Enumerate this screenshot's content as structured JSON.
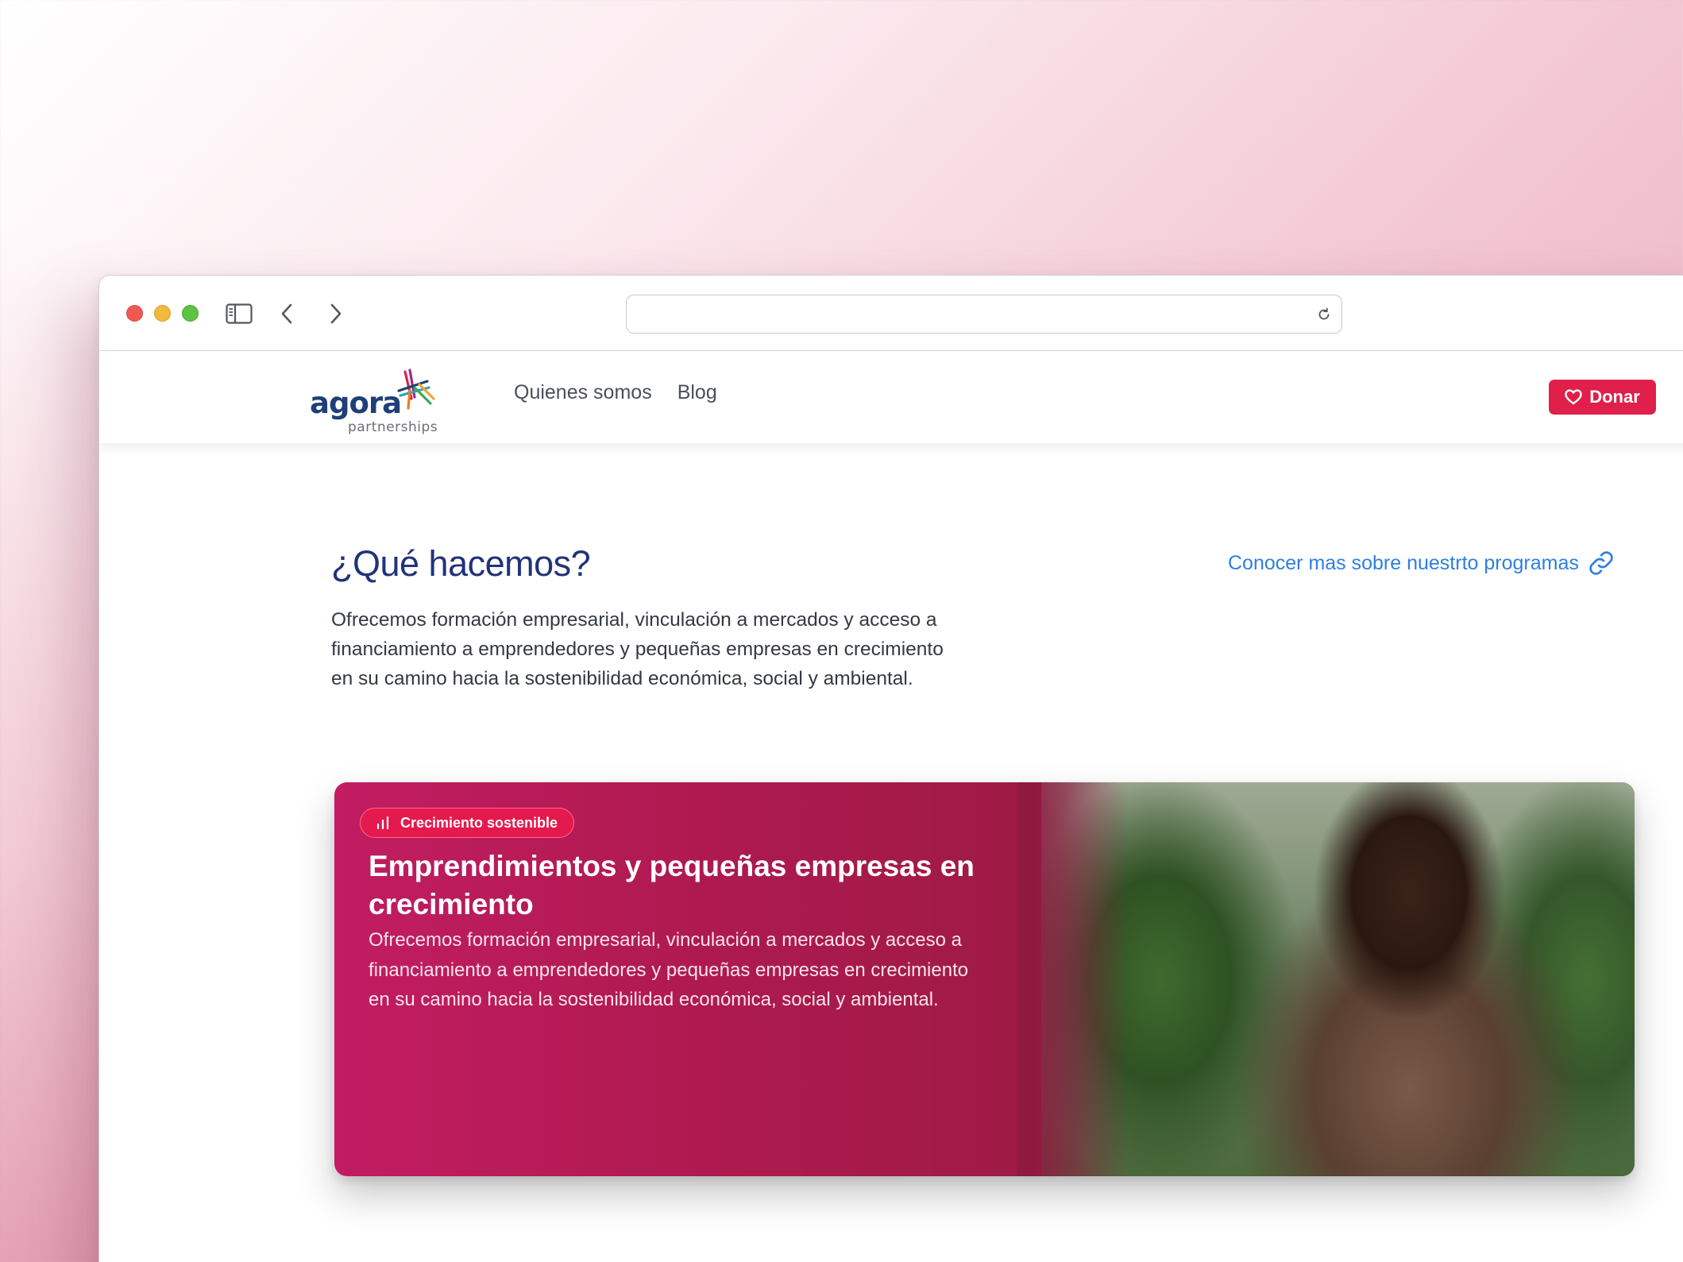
{
  "browser": {
    "url": ""
  },
  "site": {
    "logo_word": "agora",
    "logo_sub": "partnerships",
    "nav": [
      {
        "label": "Quienes somos"
      },
      {
        "label": "Blog"
      }
    ],
    "donate_label": "Donar"
  },
  "section": {
    "title": "¿Qué hacemos?",
    "description": "Ofrecemos formación empresarial, vinculación a mercados y acceso a financiamiento a emprendedores y pequeñas empresas en crecimiento en su camino hacia la sostenibilidad económica, social y ambiental.",
    "more_link": "Conocer mas sobre nuestrto programas"
  },
  "card": {
    "badge": "Crecimiento sostenible",
    "title": "Emprendimientos y pequeñas empresas en crecimiento",
    "description": "Ofrecemos formación empresarial, vinculación a mercados y acceso a financiamiento a emprendedores y pequeñas empresas en crecimiento en su camino hacia la sostenibilidad económica, social y ambiental."
  },
  "colors": {
    "brand_navy": "#1f3f7a",
    "accent_red": "#e0204a",
    "link_blue": "#2f7fe0",
    "card_magenta": "#ad1a4e"
  },
  "icons": [
    "sidebar-icon",
    "chevron-left-icon",
    "chevron-right-icon",
    "reload-icon",
    "heart-icon",
    "link-icon",
    "bar-chart-icon"
  ]
}
